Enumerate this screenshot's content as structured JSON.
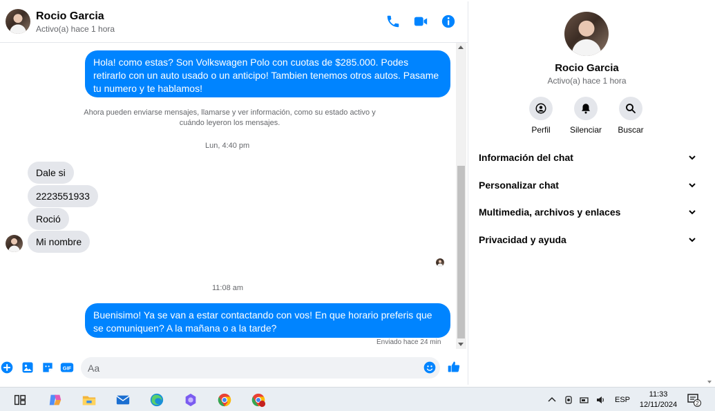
{
  "contact": {
    "name": "Rocio Garcia",
    "status": "Activo(a) hace 1 hora"
  },
  "header_icons": [
    "phone-icon",
    "video-camera-icon",
    "info-icon"
  ],
  "messages": {
    "outgoing_1": "Hola! como estas? Son Volkswagen Polo con cuotas de $285.000. Podes retirarlo con un auto usado o un anticipo! Tambien tenemos otros autos. Pasame tu numero y te hablamos!",
    "notice": "Ahora pueden enviarse mensajes, llamarse y ver información, como su estado activo y cuándo leyeron los mensajes.",
    "timestamp_1": "Lun, 4:40 pm",
    "incoming": [
      "Dale si",
      "2223551933",
      "Roció",
      "Mi nombre"
    ],
    "timestamp_2": "11:08 am",
    "outgoing_2": "Buenisimo! Ya se van a estar contactando con vos! En que horario preferis que se comuniquen? A la mañana o a la tarde?",
    "sent_status": "Enviado hace 24 min"
  },
  "composer": {
    "placeholder": "Aa",
    "icons": [
      "plus-icon",
      "image-icon",
      "sticker-icon",
      "gif-icon",
      "emoji-icon",
      "like-icon"
    ]
  },
  "panel": {
    "name": "Rocio Garcia",
    "status": "Activo(a) hace 1 hora",
    "actions": [
      "Perfil",
      "Silenciar",
      "Buscar"
    ],
    "sections": [
      "Información del chat",
      "Personalizar chat",
      "Multimedia, archivos y enlaces",
      "Privacidad y ayuda"
    ]
  },
  "taskbar": {
    "language": "ESP",
    "time": "11:33",
    "date": "12/11/2024",
    "notification_count": "2"
  },
  "colors": {
    "accent": "#0084ff",
    "incoming_bubble": "#e4e6eb",
    "secondary_text": "#65676b"
  }
}
